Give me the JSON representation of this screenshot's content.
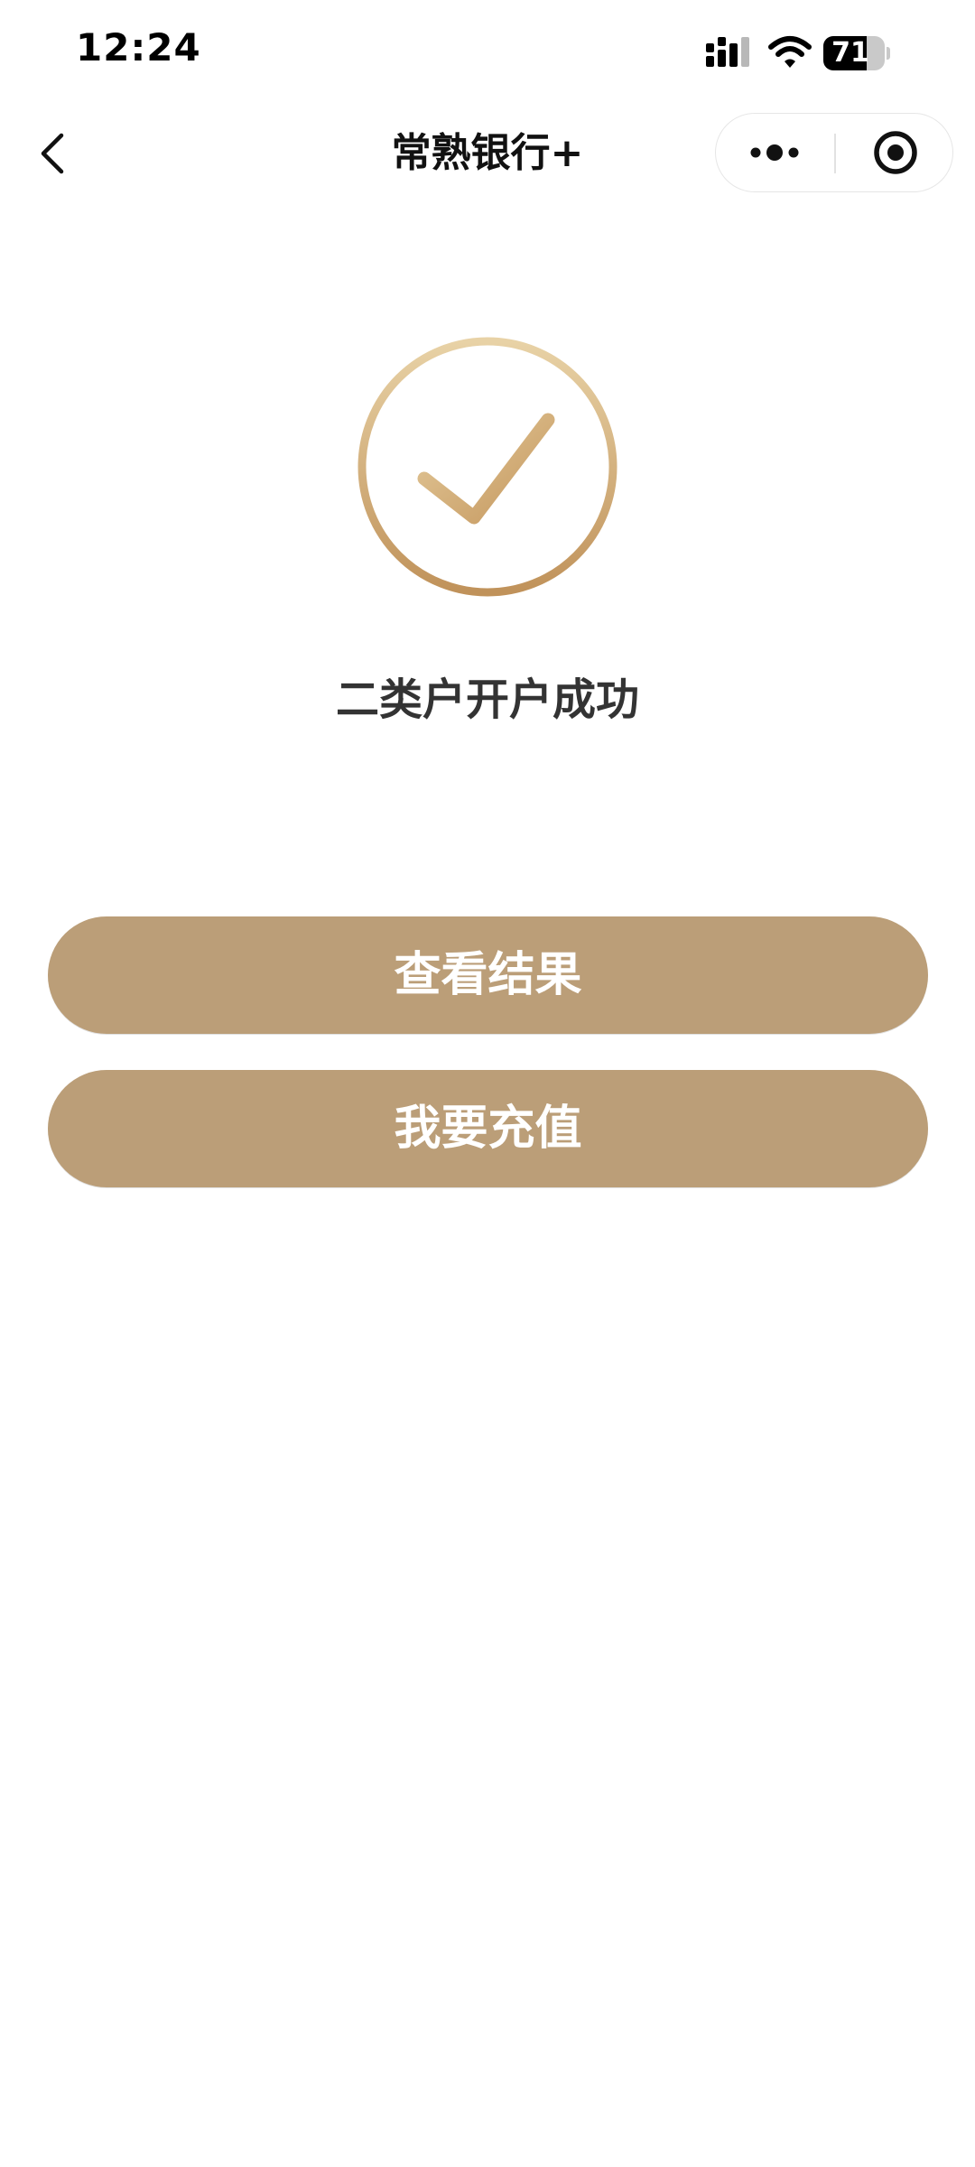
{
  "status_bar": {
    "time": "12:24",
    "battery_level": "71",
    "battery_fraction": 0.71
  },
  "nav": {
    "title": "常熟银行+",
    "icons": {
      "back": "chevron-left-icon",
      "more": "more-dots-icon",
      "close": "close-circle-icon"
    }
  },
  "result": {
    "icon": "success-check-icon",
    "message": "二类户开户成功"
  },
  "actions": {
    "view_result_label": "查看结果",
    "recharge_label": "我要充值"
  },
  "colors": {
    "accent": "#bb9e78",
    "icon_gold_light": "#e8d2a6",
    "icon_gold_dark": "#c0925a",
    "text_primary": "#333333"
  }
}
